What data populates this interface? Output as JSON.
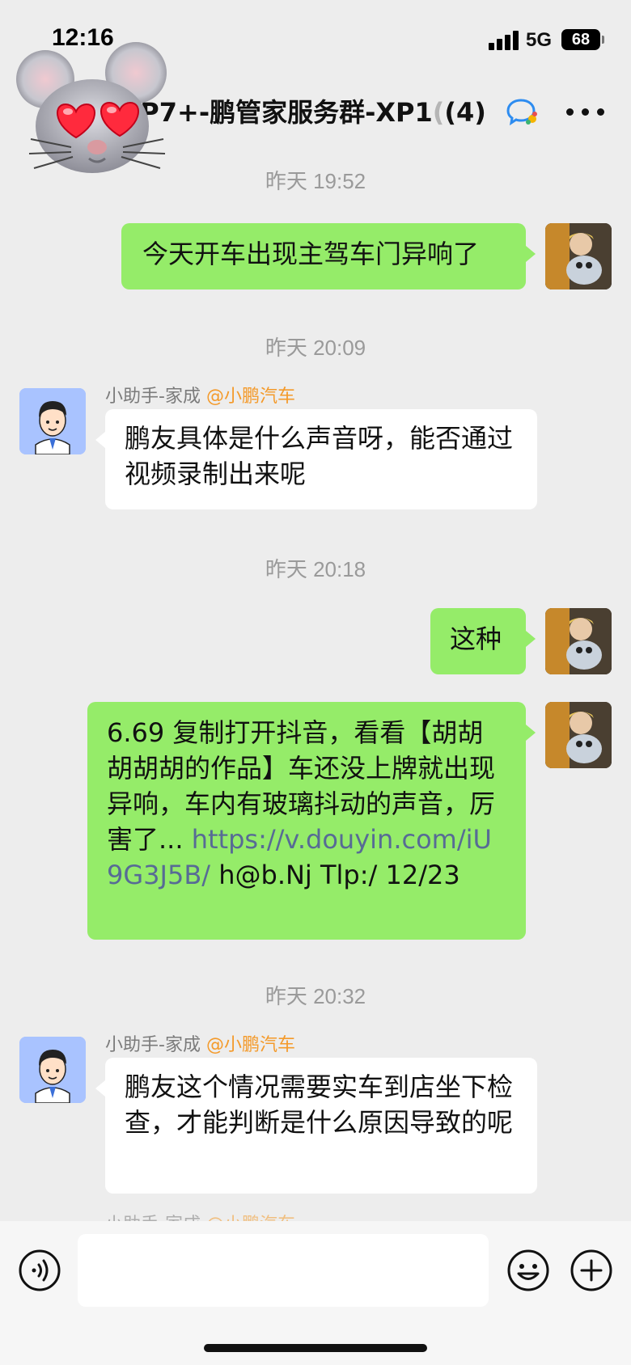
{
  "status_bar": {
    "time": "12:16",
    "network": "5G",
    "battery": "68"
  },
  "header": {
    "title": "-P7+-鹏管家服务群-XP1",
    "title_overlap": "(",
    "member_count": "(4)"
  },
  "messages": [
    {
      "type": "timestamp",
      "text": "昨天 19:52"
    },
    {
      "type": "self",
      "text": "今天开车出现主驾车门异响了"
    },
    {
      "type": "timestamp",
      "text": "昨天 20:09"
    },
    {
      "type": "other",
      "sender_name": "小助手-家成",
      "sender_org": "@小鹏汽车",
      "text": "鹏友具体是什么声音呀，能否通过视频录制出来呢"
    },
    {
      "type": "timestamp",
      "text": "昨天 20:18"
    },
    {
      "type": "self",
      "text": "这种"
    },
    {
      "type": "self_link",
      "text": "6.69 复制打开抖音，看看【胡胡胡胡胡的作品】车还没上牌就出现异响，车内有玻璃抖动的声音，厉害了... ",
      "link": "https://v.douyin.com/iU9G3J5B/",
      "suffix": " h@b.Nj Tlp:/ 12/23"
    },
    {
      "type": "timestamp",
      "text": "昨天 20:32"
    },
    {
      "type": "other",
      "sender_name": "小助手-家成",
      "sender_org": "@小鹏汽车",
      "text": "鹏友这个情况需要实车到店坐下检查，才能判断是什么原因导致的呢"
    },
    {
      "type": "other_partial",
      "sender_name": "小助手-家成",
      "sender_org": "@小鹏汽车"
    }
  ],
  "input_bar": {
    "placeholder": ""
  },
  "colors": {
    "self_bubble": "#95ec69",
    "other_bubble": "#ffffff",
    "background": "#ededed",
    "org_tag": "#f49a2a",
    "link": "#576b95"
  },
  "icons": [
    "memoji-mouse-heart-eyes",
    "signal-icon",
    "battery-icon",
    "wecom-icon",
    "more-icon",
    "voice-icon",
    "emoji-icon",
    "plus-icon"
  ]
}
